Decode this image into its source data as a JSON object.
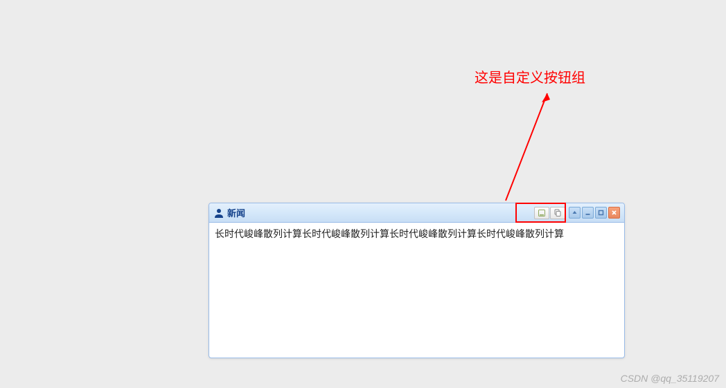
{
  "annotation": {
    "label": "这是自定义按钮组"
  },
  "panel": {
    "title": "新闻",
    "icon": "user-icon",
    "content": "长时代峻峰散列计算长时代峻峰散列计算长时代峻峰散列计算长时代峻峰散列计算",
    "customTools": [
      {
        "name": "custom-tool-1",
        "icon": "page-icon"
      },
      {
        "name": "custom-tool-2",
        "icon": "copy-icon"
      }
    ],
    "standardTools": {
      "collapse": "collapse",
      "minimize": "minimize",
      "maximize": "maximize",
      "close": "close"
    }
  },
  "watermark": "CSDN @qq_35119207",
  "colors": {
    "annotation": "#ff0000",
    "panelBorder": "#99bbe8",
    "titleColor": "#15428b",
    "closeBg": "#e9885f"
  }
}
